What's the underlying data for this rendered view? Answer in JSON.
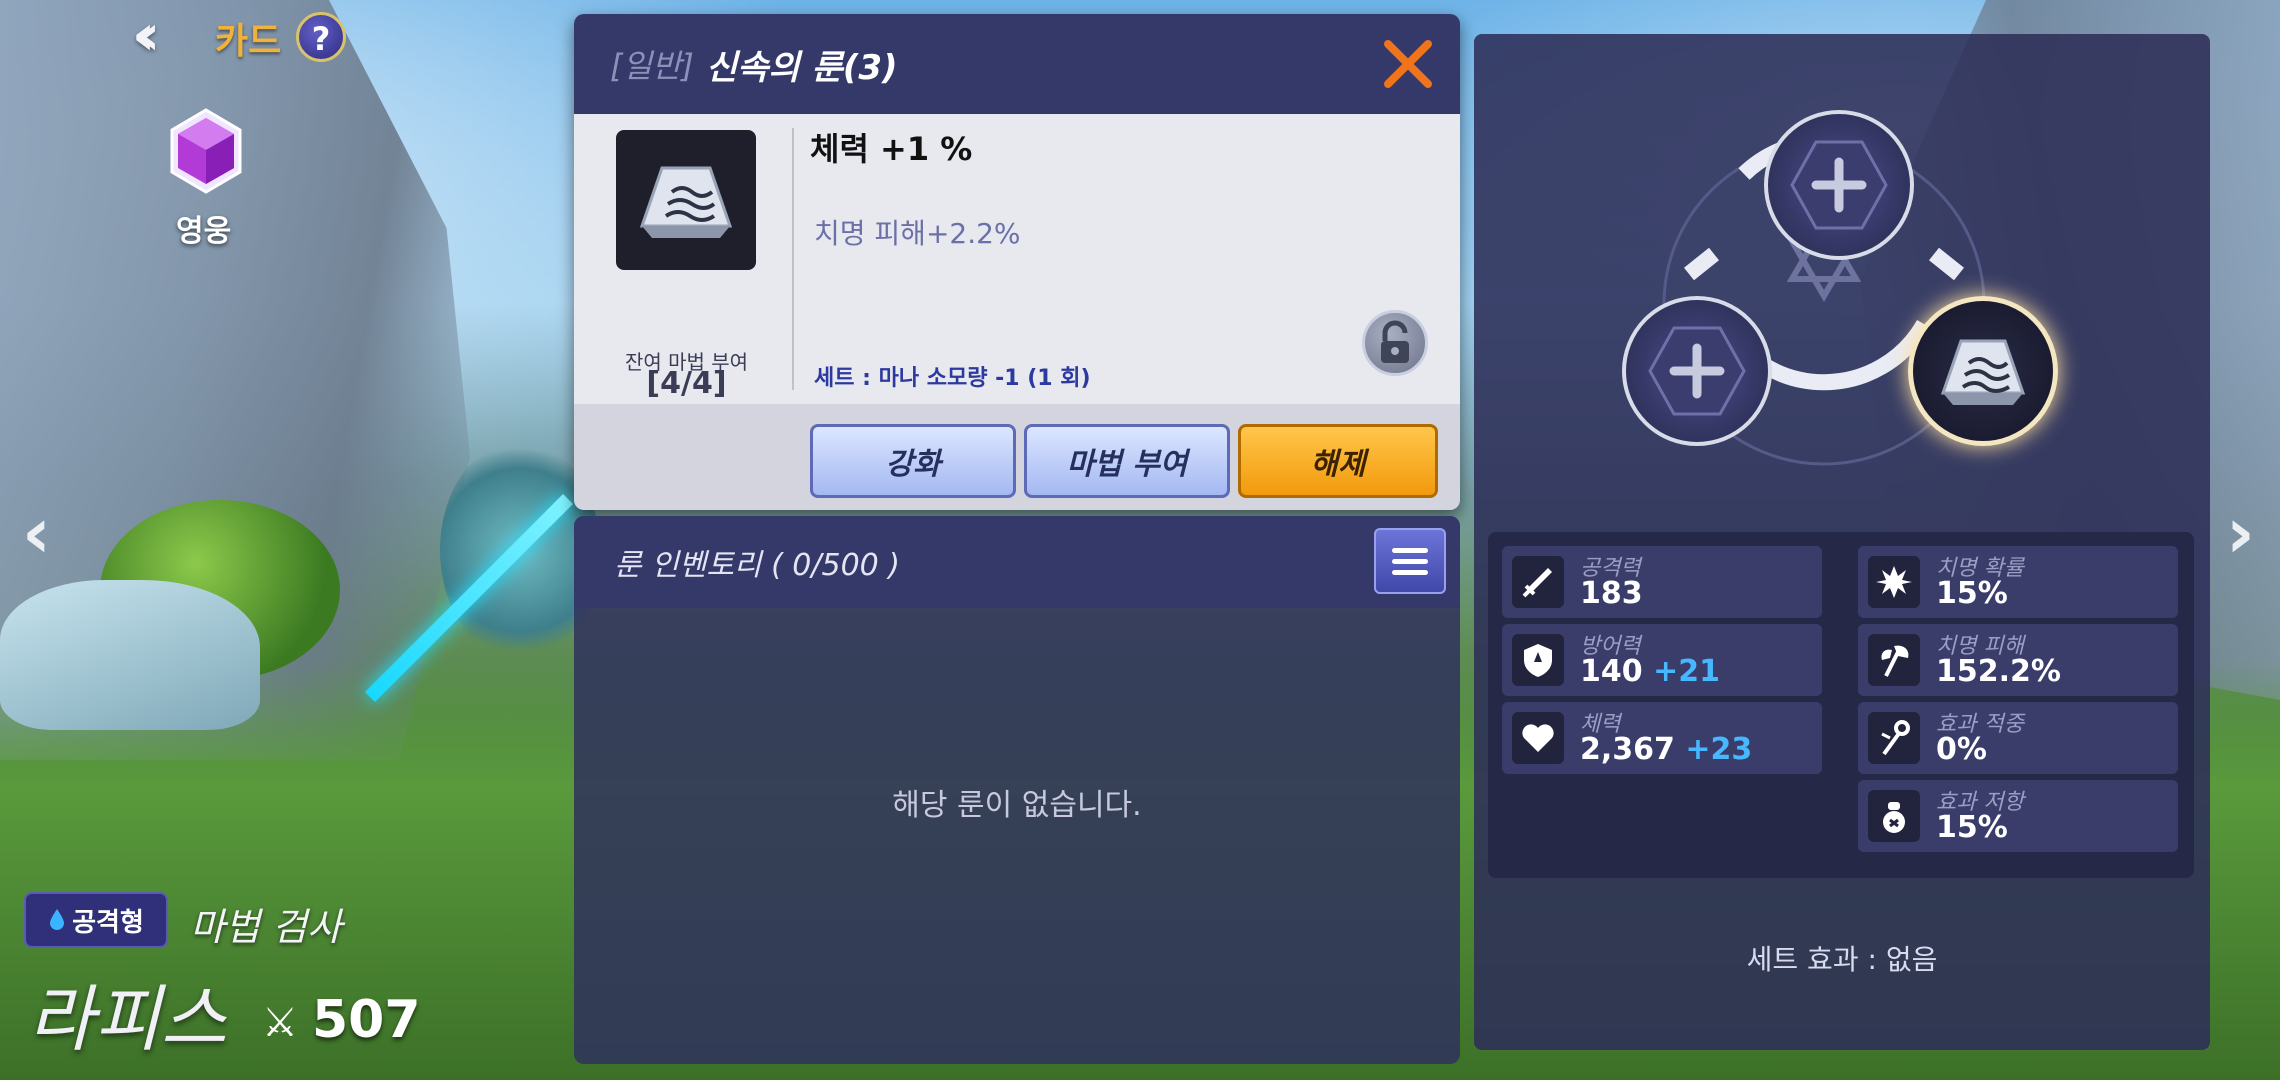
{
  "header": {
    "title": "카드",
    "help": "?"
  },
  "rank": {
    "label": "영웅"
  },
  "hero": {
    "type_badge": "공격형",
    "class_name": "마법 검사",
    "name": "라피스",
    "power": "507"
  },
  "rune_popup": {
    "grade": "[일반]",
    "title": "신속의 룬(3)",
    "main_stat": "체력 +1 %",
    "sub_stat": "치명 피해+2.2%",
    "remaining_label": "잔여 마법 부여",
    "remaining_value": "[4/4]",
    "set_info": "세트 : 마나 소모량 -1 (1 회)",
    "buttons": {
      "enhance": "강화",
      "enchant": "마법 부여",
      "unequip": "해제"
    }
  },
  "inventory": {
    "title": "룬 인벤토리 ( 0/500 )",
    "empty_message": "해당 룬이 없습니다."
  },
  "stats": [
    {
      "label": "공격력",
      "value": "183",
      "bonus": "",
      "icon": "sword-icon"
    },
    {
      "label": "치명 확률",
      "value": "15%",
      "bonus": "",
      "icon": "critical-rate-icon"
    },
    {
      "label": "방어력",
      "value": "140",
      "bonus": "+21",
      "icon": "shield-icon"
    },
    {
      "label": "치명 피해",
      "value": "152.2%",
      "bonus": "",
      "icon": "axe-icon"
    },
    {
      "label": "체력",
      "value": "2,367",
      "bonus": "+23",
      "icon": "heart-icon"
    },
    {
      "label": "효과 적중",
      "value": "0%",
      "bonus": "",
      "icon": "staff-icon"
    },
    {
      "label": "효과 저항",
      "value": "15%",
      "bonus": "",
      "icon": "bag-icon"
    }
  ],
  "set_effect": "세트 효과 : 없음",
  "colors": {
    "accent_orange": "#f29a0c",
    "panel": "#35396a",
    "bonus_blue": "#46b8ff",
    "title_gold": "#f2b23a"
  }
}
